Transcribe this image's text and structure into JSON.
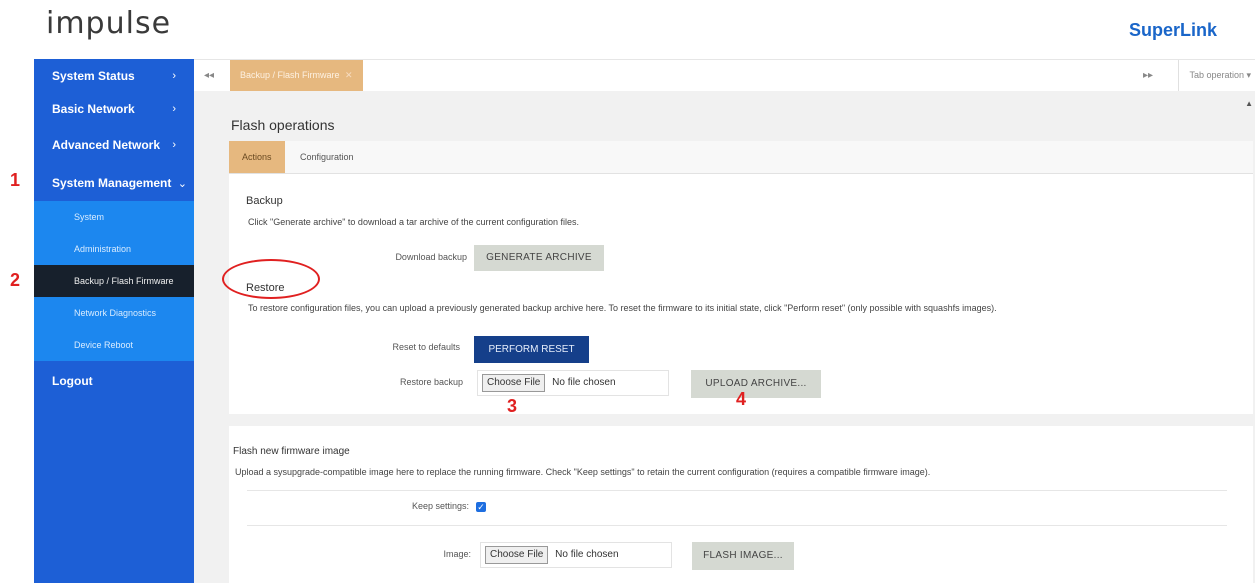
{
  "header": {
    "logo": "impulse",
    "brand": "SuperLink"
  },
  "sidebar": {
    "items": [
      {
        "label": "System Status",
        "chevron": "›"
      },
      {
        "label": "Basic Network",
        "chevron": "›"
      },
      {
        "label": "Advanced Network",
        "chevron": "›"
      },
      {
        "label": "System Management",
        "chevron": "⌄"
      }
    ],
    "sub_items": [
      "System",
      "Administration",
      "Backup / Flash Firmware",
      "Network Diagnostics",
      "Device Reboot"
    ],
    "logout": "Logout"
  },
  "tabbar": {
    "nav_left": "◂◂",
    "tab_label": "Backup / Flash Firmware",
    "tab_close": "✕",
    "nav_right": "▸▸",
    "tab_operation": "Tab operation ▾"
  },
  "page": {
    "title": "Flash operations",
    "tabs": [
      "Actions",
      "Configuration"
    ]
  },
  "backup": {
    "title": "Backup",
    "desc": "Click \"Generate archive\" to download a tar archive of the current configuration files.",
    "download_label": "Download backup",
    "generate_btn": "GENERATE ARCHIVE"
  },
  "restore": {
    "title": "Restore",
    "desc": "To restore configuration files, you can upload a previously generated backup archive here. To reset the firmware to its initial state, click \"Perform reset\" (only possible with squashfs images).",
    "reset_label": "Reset to defaults",
    "reset_btn": "PERFORM RESET",
    "restore_label": "Restore backup",
    "choose_file": "Choose File",
    "no_file": "No file chosen",
    "upload_btn": "UPLOAD ARCHIVE..."
  },
  "flash": {
    "title": "Flash new firmware image",
    "desc": "Upload a sysupgrade-compatible image here to replace the running firmware. Check \"Keep settings\" to retain the current configuration (requires a compatible firmware image).",
    "keep_label": "Keep settings:",
    "image_label": "Image:",
    "choose_file": "Choose File",
    "no_file": "No file chosen",
    "flash_btn": "FLASH IMAGE..."
  },
  "annotations": [
    "1",
    "2",
    "3",
    "4"
  ],
  "colors": {
    "sidebar": "#1d5fd6",
    "submenu": "#1c87ef",
    "active_tab": "#e6b87f",
    "marker": "#e02020"
  }
}
